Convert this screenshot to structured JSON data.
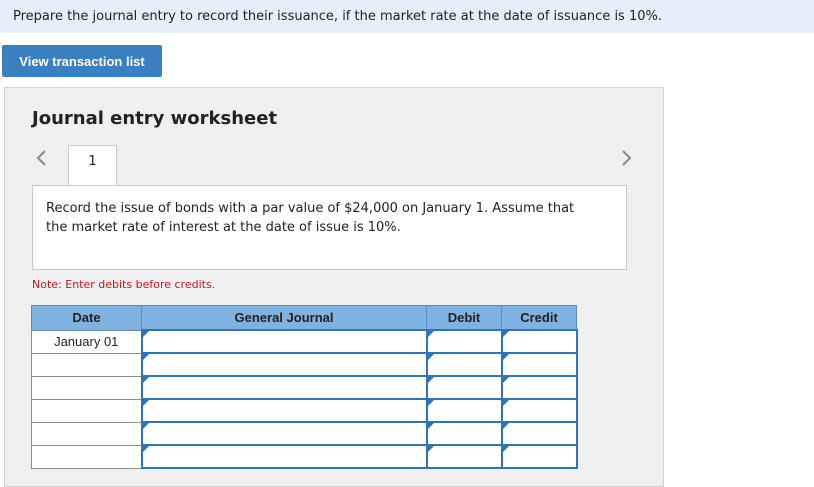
{
  "prompt": {
    "text": "Prepare the journal entry to record their issuance, if the market rate at the date of issuance is 10%."
  },
  "buttons": {
    "view_transaction_list": "View transaction list"
  },
  "worksheet": {
    "title": "Journal entry worksheet",
    "tabs": [
      {
        "label": "1"
      }
    ],
    "description": "Record the issue of bonds with a par value of $24,000 on January 1. Assume that the market rate of interest at the date of issue is 10%.",
    "note": "Note: Enter debits before credits.",
    "table": {
      "headers": {
        "date": "Date",
        "general_journal": "General Journal",
        "debit": "Debit",
        "credit": "Credit"
      },
      "rows": [
        {
          "date": "January 01"
        },
        {
          "date": ""
        },
        {
          "date": ""
        },
        {
          "date": ""
        },
        {
          "date": ""
        },
        {
          "date": ""
        }
      ]
    }
  },
  "colors": {
    "prompt_bg": "#e4eff9",
    "button": "#3a7fc0",
    "header": "#7fb2e0",
    "note": "#c0191e",
    "input_border": "#2f74b5"
  },
  "icons": {
    "prev": "chevron-left-icon",
    "next": "chevron-right-icon"
  }
}
